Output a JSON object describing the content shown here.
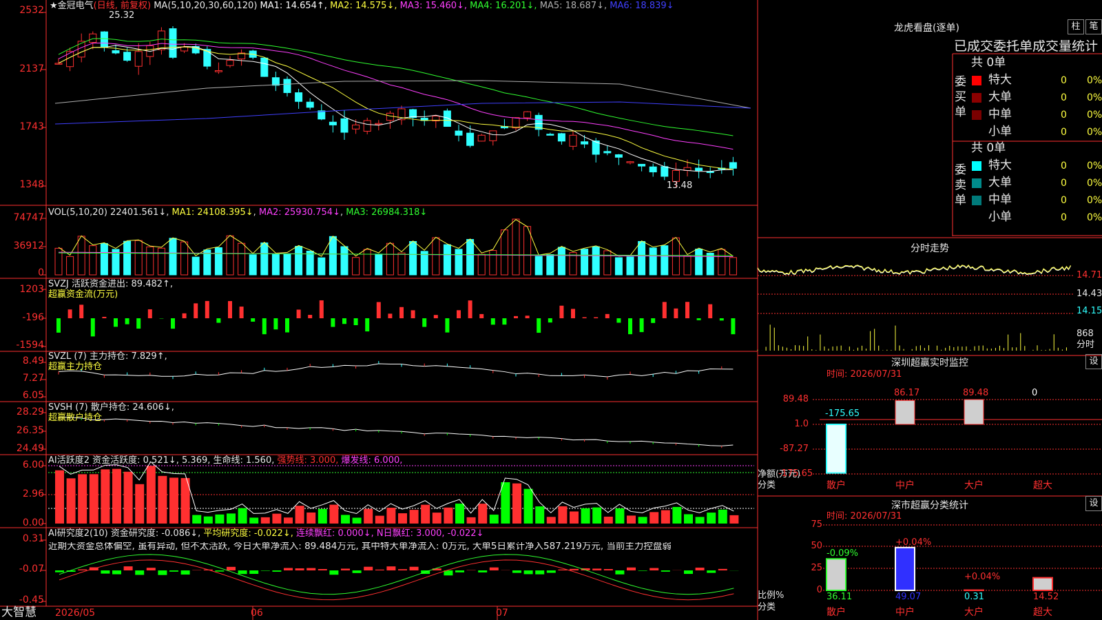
{
  "stock": {
    "name": "★金冠电气",
    "period_note": "(日线, 前复权)",
    "high_mark": "25.32",
    "low_mark": "13.48",
    "ma_label": "MA(5,10,20,30,60,120)",
    "ma_values": [
      {
        "text": "MA1: 14.654↑",
        "color": "#ffffff"
      },
      {
        "text": "MA2: 14.575↓",
        "color": "#ffff40"
      },
      {
        "text": "MA3: 15.460↓",
        "color": "#ff40ff"
      },
      {
        "text": "MA4: 16.201↓",
        "color": "#30ff30"
      },
      {
        "text": "MA5: 18.687↓",
        "color": "#b0b0b0"
      },
      {
        "text": "MA6: 18.839↓",
        "color": "#4040ff"
      }
    ],
    "price_axis": [
      "2532",
      "2137",
      "1743",
      "1348"
    ]
  },
  "vol": {
    "label": "VOL(5,10,20)",
    "value": "22401.561↓",
    "ma1": "MA1: 24108.395↓",
    "ma2": "MA2: 25930.754↓",
    "ma3": "MA3: 26984.318↓",
    "axis": [
      "74747",
      "36912",
      "0"
    ]
  },
  "svzj": {
    "label": "SVZJ  活跃资金进出: 89.482↑,",
    "sub": "超赢资金流(万元)",
    "axis": [
      "1203",
      "-196",
      "-1594"
    ]
  },
  "svzl": {
    "label": "SVZL (7) 主力持仓: 7.829↑,",
    "sub": "超赢主力持仓",
    "axis": [
      "8.49",
      "7.27",
      "6.05"
    ]
  },
  "svsh": {
    "label": "SVSH (7) 散户持仓: 24.606↓,",
    "sub": "超赢散户持仓",
    "axis": [
      "28.29",
      "26.35",
      "24.49"
    ]
  },
  "ai1": {
    "label": "AI活跃度2 资金活跃度: 0.521↓, 5.369, 生命线: 1.560,",
    "strong": "强势线: 3.000,",
    "burst": "爆发线: 6.000,",
    "axis": [
      "6.00",
      "2.96",
      "0.00"
    ]
  },
  "ai2": {
    "label": "AI研究度2(10) 资金研究度: -0.086↓,",
    "avg": "平均研究度: -0.022↓,",
    "red": "连续飘红: 0.000↓,",
    "nday": "N日飘红: 3.000, -0.022↓",
    "comment": "近期大资金总体偏空, 虽有异动, 但不太活跃, 今日大单净流入: 89.484万元, 其中特大单净流入: 0万元, 大单5日累计净入587.219万元, 当前主力控盘弱",
    "axis": [
      "0.31",
      "-0.07",
      "-0.45"
    ]
  },
  "dates": {
    "brand": "大智慧",
    "d1": "2026/05",
    "d2": "06",
    "d3": "07"
  },
  "lhb": {
    "title": "龙虎看盘(逐单)",
    "btn1": "柱",
    "btn2": "笔",
    "tabs": "已成交委托单成交量统计",
    "buy_side": "委\n买\n单",
    "sell_side": "委\n卖\n单",
    "buy_total": "共 0单",
    "sell_total": "共 0单",
    "rows": [
      {
        "label": "特大",
        "val": "0",
        "pct": "0%"
      },
      {
        "label": "大单",
        "val": "0",
        "pct": "0%"
      },
      {
        "label": "中单",
        "val": "0",
        "pct": "0%"
      },
      {
        "label": "小单",
        "val": "0",
        "pct": "0%"
      }
    ]
  },
  "intraday": {
    "title": "分时走势",
    "p1": "14.71",
    "p2": "14.43",
    "p3": "14.15",
    "v1": "868",
    "v2": "分时"
  },
  "sz_monitor": {
    "title": "深圳超赢实时监控",
    "btn": "设",
    "time": "时间: 2026/07/31",
    "axis": [
      "89.48",
      "1.0",
      "-87.27",
      "-175.65"
    ],
    "ylabel": "净额(万元)",
    "xlabel": "分类",
    "bars": [
      {
        "cat": "散户",
        "value": "-175.65"
      },
      {
        "cat": "中户",
        "value": "86.17"
      },
      {
        "cat": "大户",
        "value": "89.48"
      },
      {
        "cat": "超大",
        "value": "0"
      }
    ]
  },
  "sz_class": {
    "title": "深市超赢分类统计",
    "btn": "设",
    "time": "时间: 2026/07/31",
    "axis": [
      "75",
      "50",
      "25",
      "0"
    ],
    "ylabel": "比例%",
    "xlabel": "分类",
    "bars": [
      {
        "cat": "散户",
        "pct": "36.11",
        "delta": "-0.09%"
      },
      {
        "cat": "中户",
        "pct": "49.07",
        "delta": "+0.04%"
      },
      {
        "cat": "大户",
        "pct": "0.31",
        "delta": "+0.04%"
      },
      {
        "cat": "超大",
        "pct": "14.52",
        "delta": ""
      }
    ]
  }
}
